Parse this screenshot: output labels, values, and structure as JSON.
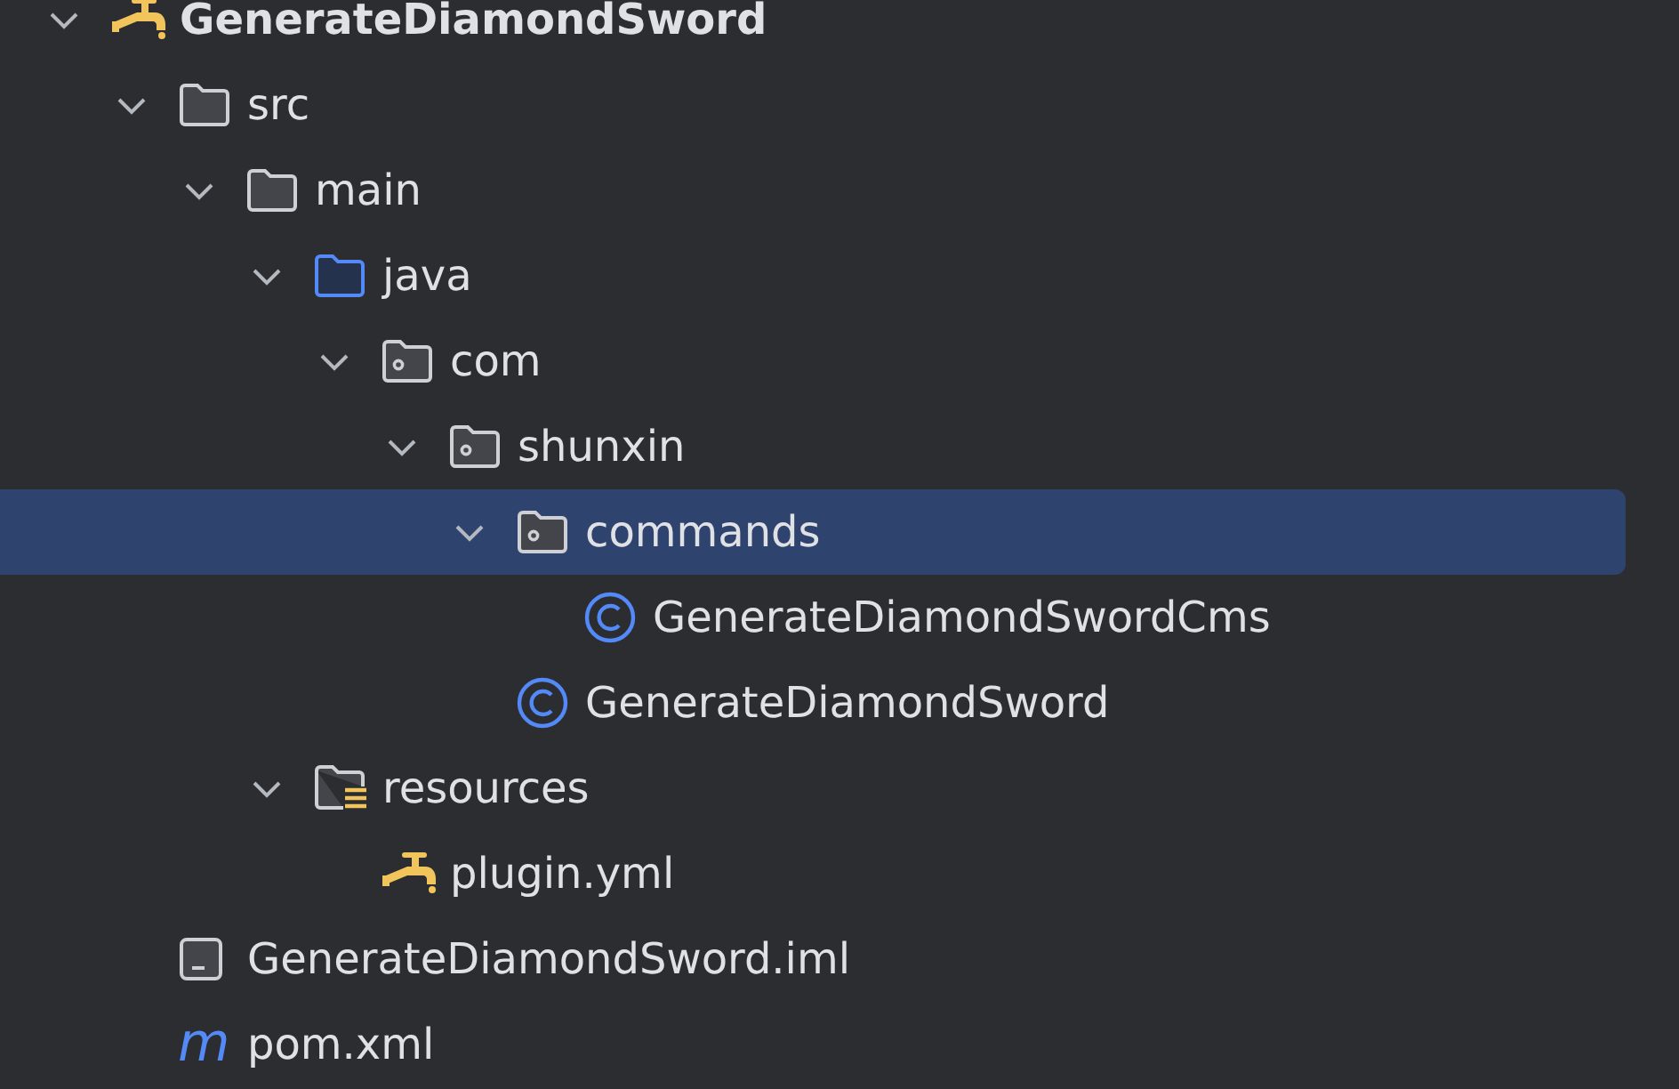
{
  "project_tree": [
    {
      "kind": "project",
      "label": "GenerateDiamondSword",
      "expanded": true,
      "selected": false,
      "children": [
        {
          "kind": "folder",
          "label": "src",
          "expanded": true,
          "selected": false,
          "children": [
            {
              "kind": "folder",
              "label": "main",
              "expanded": true,
              "selected": false,
              "children": [
                {
                  "kind": "source-folder",
                  "label": "java",
                  "expanded": true,
                  "selected": false,
                  "children": [
                    {
                      "kind": "package",
                      "label": "com",
                      "expanded": true,
                      "selected": false,
                      "children": [
                        {
                          "kind": "package",
                          "label": "shunxin",
                          "expanded": true,
                          "selected": false,
                          "children": [
                            {
                              "kind": "package",
                              "label": "commands",
                              "expanded": true,
                              "selected": true,
                              "children": [
                                {
                                  "kind": "class",
                                  "label": "GenerateDiamondSwordCms",
                                  "selected": false
                                }
                              ]
                            },
                            {
                              "kind": "class",
                              "label": "GenerateDiamondSword",
                              "selected": false
                            }
                          ]
                        }
                      ]
                    }
                  ]
                },
                {
                  "kind": "resources",
                  "label": "resources",
                  "expanded": true,
                  "selected": false,
                  "children": [
                    {
                      "kind": "yml",
                      "label": "plugin.yml",
                      "selected": false
                    }
                  ]
                }
              ]
            }
          ]
        },
        {
          "kind": "iml",
          "label": "GenerateDiamondSword.iml",
          "selected": false
        },
        {
          "kind": "maven",
          "label": "pom.xml",
          "icon_text": "m",
          "selected": false
        }
      ]
    }
  ]
}
